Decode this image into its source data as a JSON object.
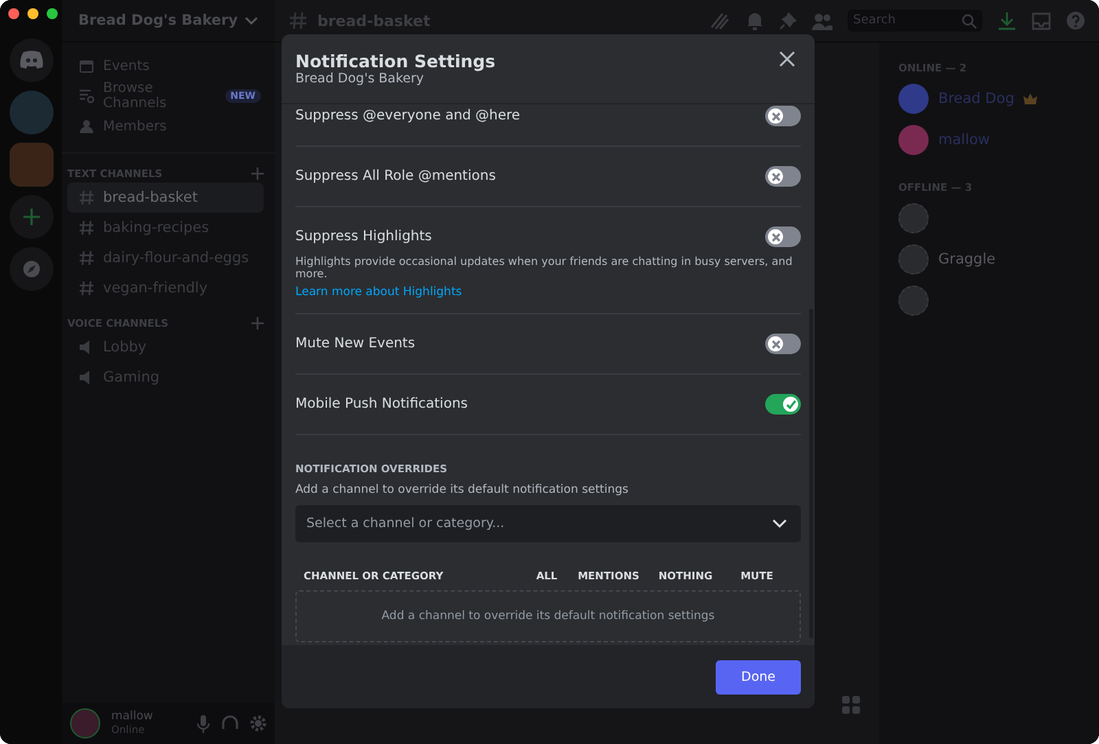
{
  "sidebar": {
    "server_name": "Bread Dog's Bakery",
    "nav": [
      {
        "kind": "events",
        "label": "Events"
      },
      {
        "kind": "browse",
        "label": "Browse Channels",
        "badge": "NEW"
      },
      {
        "kind": "members",
        "label": "Members"
      }
    ],
    "categories": [
      {
        "kind": "text",
        "name": "TEXT CHANNELS",
        "channels": [
          {
            "name": "bread-basket",
            "selected": true
          },
          {
            "name": "baking-recipes",
            "selected": false
          },
          {
            "name": "dairy-flour-and-eggs",
            "selected": false
          },
          {
            "name": "vegan-friendly",
            "selected": false
          }
        ]
      },
      {
        "kind": "voice",
        "name": "VOICE CHANNELS",
        "channels": [
          {
            "name": "Lobby",
            "selected": false
          },
          {
            "name": "Gaming",
            "selected": false
          }
        ]
      }
    ]
  },
  "user": {
    "name": "mallow",
    "status": "Online"
  },
  "channel_header": {
    "name": "bread-basket",
    "search_placeholder": "Search"
  },
  "members": [
    {
      "title": "ONLINE — 2",
      "people": [
        {
          "name": "Bread Dog",
          "online": true,
          "owner": true,
          "color": "#2f3a8a"
        },
        {
          "name": "mallow",
          "online": true,
          "color": "#7a2a50"
        }
      ]
    },
    {
      "title": "OFFLINE — 3",
      "people": [
        {
          "online": false,
          "color": "#2a2b2e"
        },
        {
          "name": "Graggle",
          "online": false,
          "color": "#2a2b2e"
        },
        {
          "online": false,
          "color": "#2a2b2e"
        }
      ]
    }
  ],
  "modal": {
    "title": "Notification Settings",
    "subtitle": "Bread Dog's Bakery",
    "settings": [
      {
        "label": "Suppress @everyone and @here",
        "on": false
      },
      {
        "label": "Suppress All Role @mentions",
        "on": false
      },
      {
        "label": "Suppress Highlights",
        "on": false,
        "description": "Highlights provide occasional updates when your friends are chatting in busy servers, and more.",
        "link": "Learn more about Highlights"
      },
      {
        "label": "Mute New Events",
        "on": false
      },
      {
        "label": "Mobile Push Notifications",
        "on": true
      }
    ],
    "overrides": {
      "heading": "NOTIFICATION OVERRIDES",
      "hint": "Add a channel to override its default notification settings",
      "select_placeholder": "Select a channel or category...",
      "columns": [
        "CHANNEL OR CATEGORY",
        "ALL",
        "MENTIONS",
        "NOTHING",
        "MUTE"
      ],
      "empty_text": "Add a channel to override its default notification settings"
    },
    "done": "Done"
  }
}
